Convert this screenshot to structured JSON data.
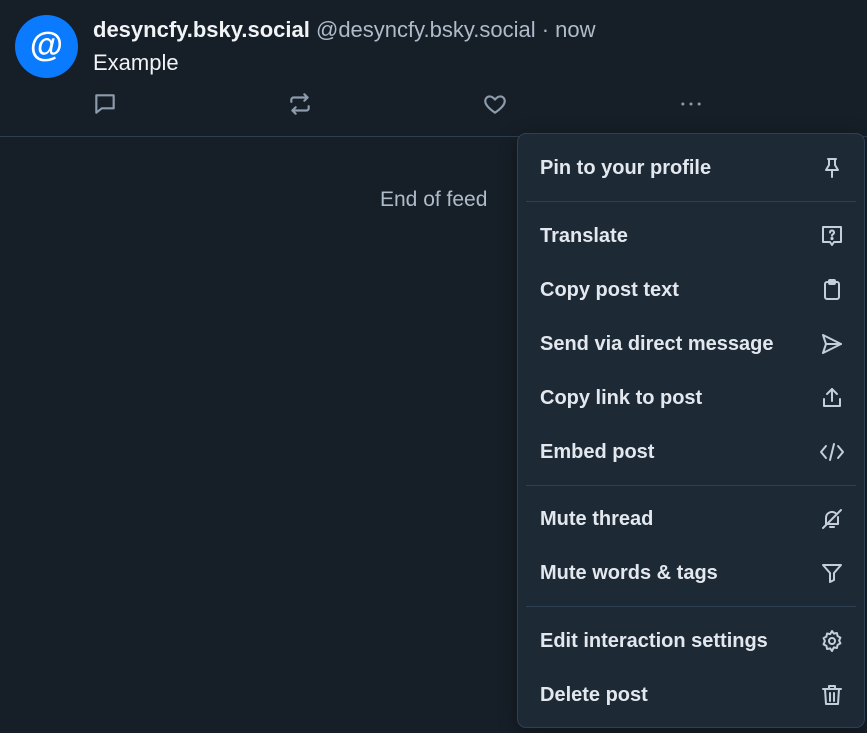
{
  "post": {
    "avatar_glyph": "@",
    "display_name": "desyncfy.bsky.social",
    "handle": "@desyncfy.bsky.social",
    "separator": " · ",
    "time": "now",
    "text": "Example",
    "actions": [
      {
        "icon": "reply-icon"
      },
      {
        "icon": "repost-icon"
      },
      {
        "icon": "like-icon"
      },
      {
        "icon": "more-icon"
      }
    ]
  },
  "feed": {
    "end_text": "End of feed"
  },
  "menu": {
    "items": [
      {
        "label": "Pin to your profile",
        "icon": "pin-icon"
      },
      {
        "label": "Translate",
        "icon": "translate-icon"
      },
      {
        "label": "Copy post text",
        "icon": "clipboard-icon"
      },
      {
        "label": "Send via direct message",
        "icon": "send-icon"
      },
      {
        "label": "Copy link to post",
        "icon": "share-icon"
      },
      {
        "label": "Embed post",
        "icon": "code-icon"
      },
      {
        "label": "Mute thread",
        "icon": "mute-bell-icon"
      },
      {
        "label": "Mute words & tags",
        "icon": "filter-icon"
      },
      {
        "label": "Edit interaction settings",
        "icon": "gear-icon"
      },
      {
        "label": "Delete post",
        "icon": "trash-icon"
      }
    ]
  },
  "colors": {
    "background": "#161e27",
    "menu_background": "#1e2936",
    "border": "#2e4052",
    "avatar": "#0a7aff",
    "muted_text": "#aebbc9"
  }
}
